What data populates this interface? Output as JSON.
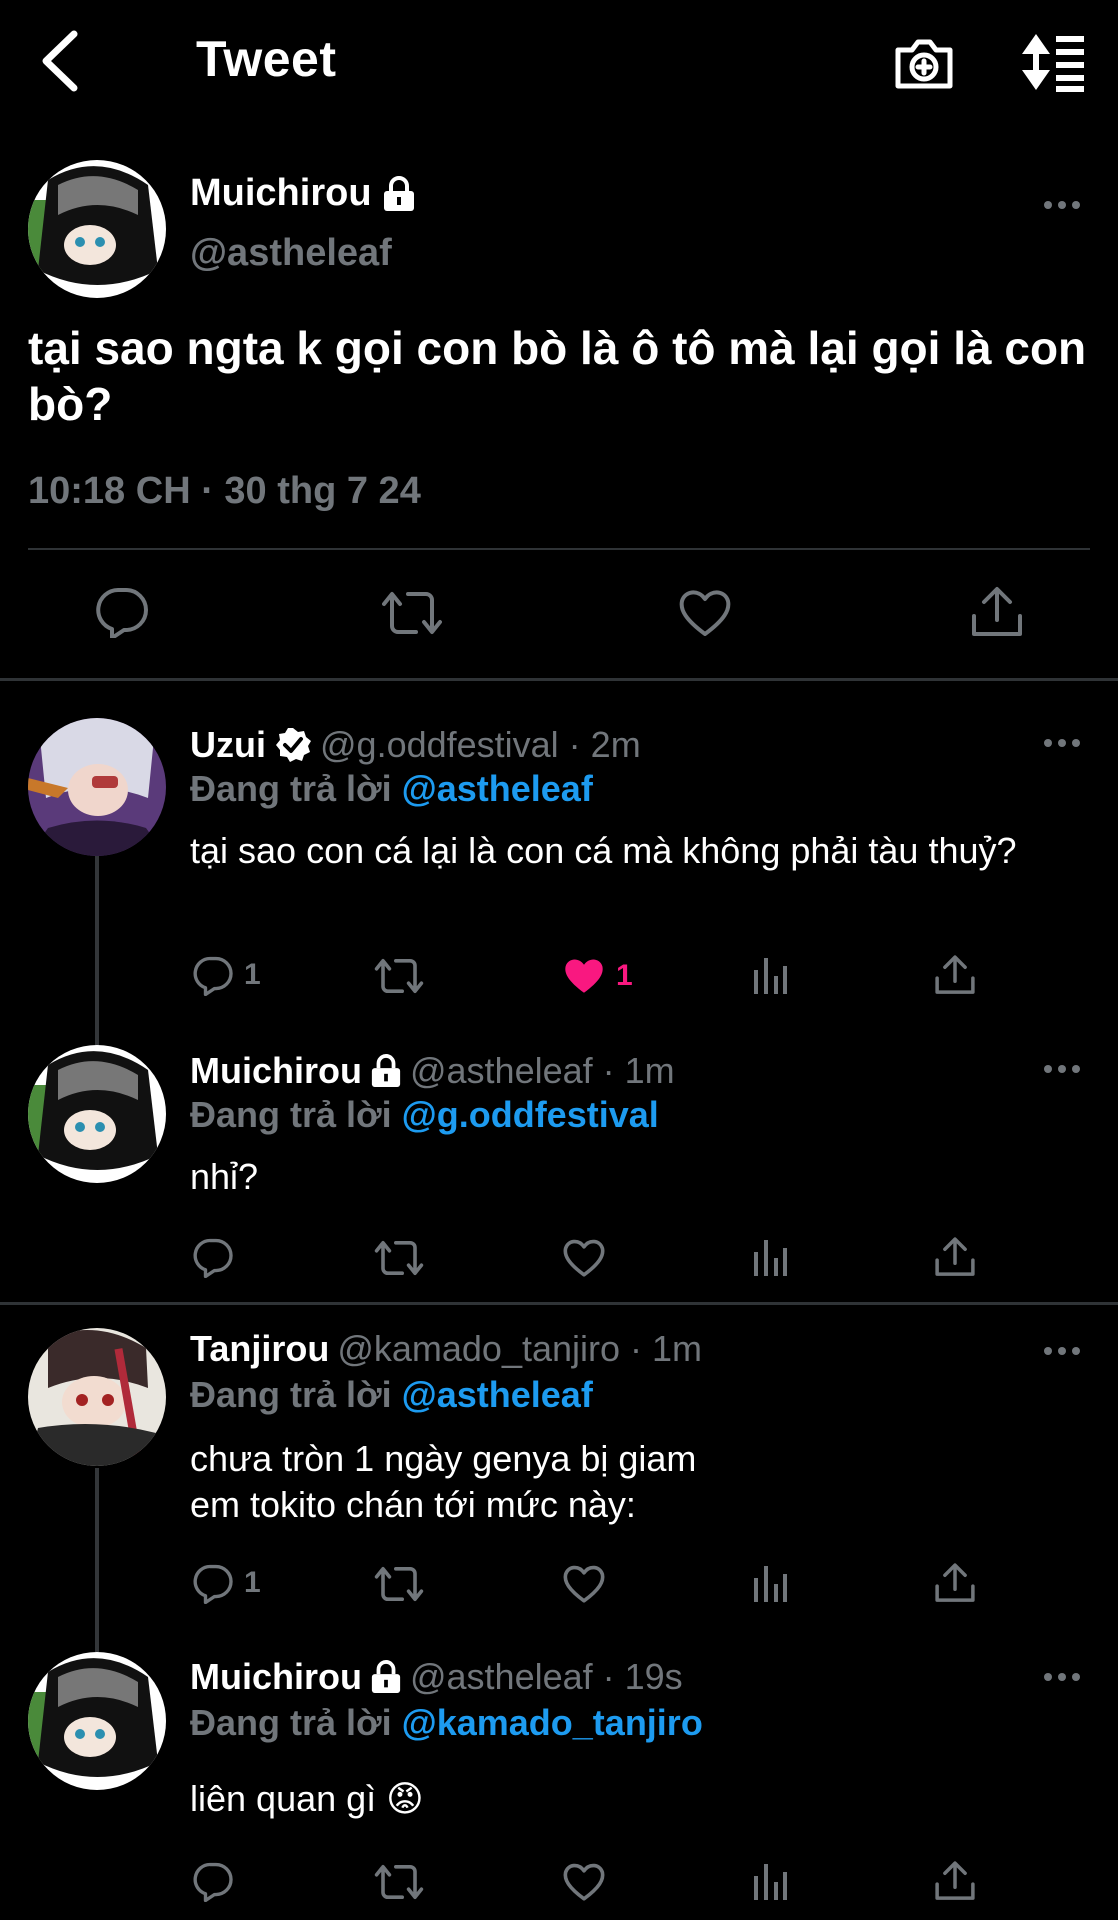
{
  "header": {
    "title": "Tweet"
  },
  "main_tweet": {
    "name": "Muichirou",
    "handle": "@astheleaf",
    "text": "tại sao ngta k gọi con bò là ô tô mà lại gọi là con bò?",
    "timestamp": "10:18 CH · 30 thg 7 24"
  },
  "replies": [
    {
      "name": "Uzui",
      "verified": true,
      "meta": "@g.oddfestival · 2m",
      "reply_prefix": "Đang trả lời ",
      "reply_to": "@astheleaf",
      "text": "tại sao con cá lại là con cá mà không phải tàu thuỷ?",
      "reply_count": "1",
      "like_count": "1"
    },
    {
      "name": "Muichirou",
      "locked": true,
      "meta": "@astheleaf · 1m",
      "reply_prefix": "Đang trả lời ",
      "reply_to": "@g.oddfestival",
      "text": "nhỉ?"
    },
    {
      "name": "Tanjirou",
      "meta": "@kamado_tanjiro · 1m",
      "reply_prefix": "Đang trả lời ",
      "reply_to": "@astheleaf",
      "text_line1": "chưa tròn 1 ngày genya bị giam",
      "text_line2": "em tokito chán tới mức này:",
      "reply_count": "1"
    },
    {
      "name": "Muichirou",
      "locked": true,
      "meta": "@astheleaf · 19s",
      "reply_prefix": "Đang trả lời ",
      "reply_to": "@kamado_tanjiro",
      "text": "liên quan gì",
      "emoji": "😡"
    }
  ],
  "colors": {
    "accent": "#1d9bf0",
    "like": "#f91880",
    "muted": "#71767b",
    "divider": "#2f3336"
  }
}
